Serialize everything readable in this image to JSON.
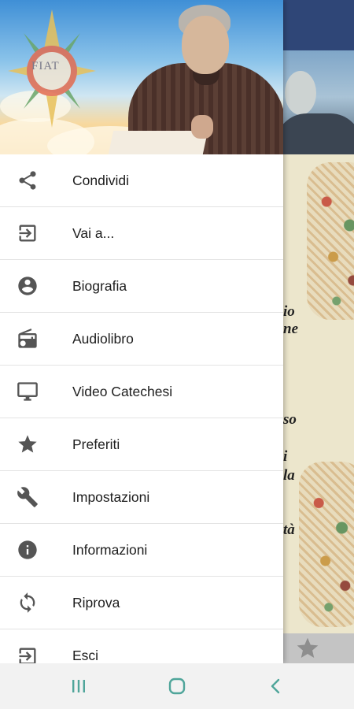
{
  "drawer": {
    "header_logo_text": "FIAT",
    "items": [
      {
        "label": "Condividi",
        "icon": "share-icon"
      },
      {
        "label": "Vai a...",
        "icon": "login-icon"
      },
      {
        "label": "Biografia",
        "icon": "account-circle-icon"
      },
      {
        "label": "Audiolibro",
        "icon": "radio-icon"
      },
      {
        "label": "Video Catechesi",
        "icon": "monitor-icon"
      },
      {
        "label": "Preferiti",
        "icon": "star-icon"
      },
      {
        "label": "Impostazioni",
        "icon": "wrench-icon"
      },
      {
        "label": "Informazioni",
        "icon": "info-icon"
      },
      {
        "label": "Riprova",
        "icon": "refresh-icon"
      },
      {
        "label": "Esci",
        "icon": "exit-icon"
      }
    ]
  },
  "background": {
    "text_fragments": [
      "io",
      "ne",
      "so",
      "i",
      "la",
      "tà"
    ],
    "bottom_icon": "star-icon"
  },
  "navbar": {
    "recent": "recent-apps-icon",
    "home": "home-icon",
    "back": "back-icon"
  },
  "colors": {
    "topbar": "#2f4677",
    "icon_gray": "#555555",
    "divider": "#e3e3e3",
    "navbar_bg": "#f2f2f2",
    "nav_icon": "#4fa59a"
  }
}
